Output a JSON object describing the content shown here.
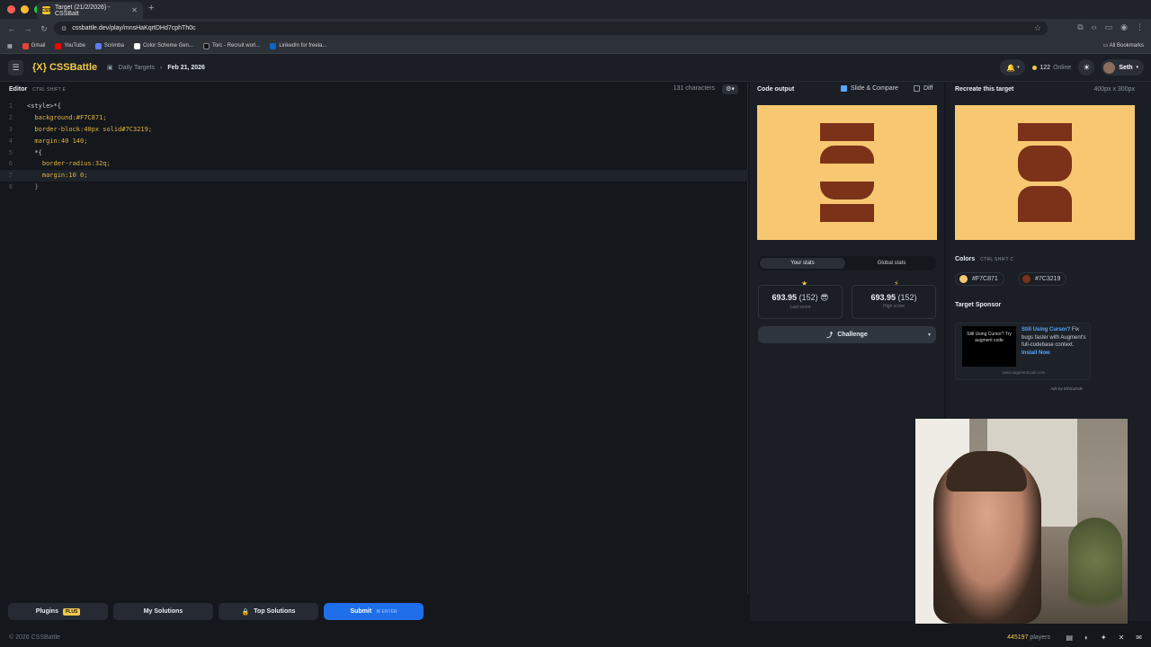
{
  "browser": {
    "tab_title": "Target (21/2/2026) - CSSBatt",
    "tab_favicon": "CSS",
    "url": "cssbattle.dev/play/mnsHaKqrtDHd7cphTh0c",
    "bookmarks": [
      "Gmail",
      "YouTube",
      "Scrimba",
      "Color Scheme Gen...",
      "Torc - Recruit worl...",
      "LinkedIn for freela..."
    ],
    "bookmark_colors": [
      "#ea4335",
      "#ff0000",
      "#5f7cff",
      "#ffffff",
      "#111111",
      "#0a66c2"
    ],
    "all_bookmarks": "All Bookmarks"
  },
  "header": {
    "logo": "{X} CSSBattle",
    "breadcrumb_parent": "Daily Targets",
    "breadcrumb_current": "Feb 21, 2026",
    "online_count": "122",
    "online_label": "Online",
    "user_name": "Seth"
  },
  "editor": {
    "title": "Editor",
    "shortcut": "CTRL  SHIFT  E",
    "char_count": "131 characters",
    "lines": [
      "<style>*{",
      "  background:#F7C871;",
      "  border-block:40px solid#7C3219;",
      "  margin:40 140;",
      "  *{",
      "    border-radius:32q;",
      "    margin:10 0;",
      "  }"
    ]
  },
  "buttons": {
    "plugins": "Plugins",
    "plus_badge": "PLUS",
    "my_solutions": "My Solutions",
    "top_solutions": "Top Solutions",
    "submit": "Submit",
    "submit_shortcut": "ENTER"
  },
  "output": {
    "title": "Code output",
    "slide_compare": "Slide & Compare",
    "diff": "Diff"
  },
  "stats": {
    "tab_yours": "Your stats",
    "tab_global": "Global stats",
    "last_score": "693.95",
    "last_count": "(152)",
    "last_label": "Last score",
    "high_score": "693.95",
    "high_count": "(152)",
    "high_label": "High score",
    "challenge": "Challenge"
  },
  "target": {
    "title": "Recreate this target",
    "size": "400px x 300px",
    "colors_title": "Colors",
    "colors_shortcut": "CTRL  SHIFT  C",
    "color_1": "#F7C871",
    "color_2": "#7C3219",
    "sponsor_title": "Target Sponsor",
    "ad_image_text": "Still Using Cursor? Try augment code",
    "ad_headline": "Still Using Cursor?",
    "ad_body": "Fix bugs faster with Augment's full-codebase context.",
    "ad_cta": "Install Now",
    "ad_url": "www.augmentcode.com",
    "ads_by": "Ads by EthicalAds"
  },
  "footer": {
    "copyright": "© 2026 CSSBattle",
    "players_count": "445197",
    "players_label": "players"
  },
  "colors": {
    "canvas_bg": "#F7C871",
    "shape": "#7C3219",
    "accent": "#f2c94c",
    "submit_blue": "#1f6feb"
  }
}
